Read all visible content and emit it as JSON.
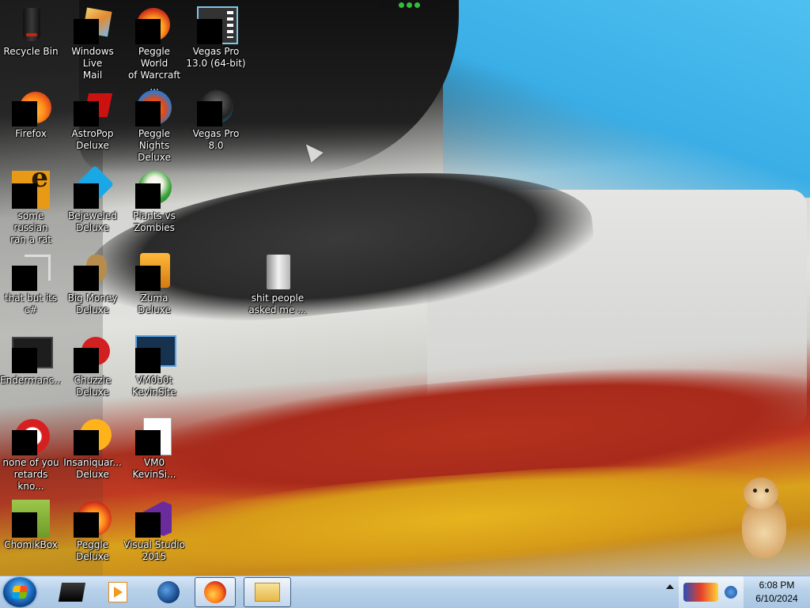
{
  "desktop": {
    "icons": [
      {
        "label": "Recycle Bin",
        "icon": "recycle-bin-icon"
      },
      {
        "label": "Windows Live\nMail",
        "icon": "mail-icon"
      },
      {
        "label": "Peggle World\nof Warcraft ...",
        "icon": "peggle-icon"
      },
      {
        "label": "Vegas Pro\n13.0 (64-bit)",
        "icon": "vegas-icon"
      },
      {
        "label": "Firefox",
        "icon": "firefox-icon"
      },
      {
        "label": "AstroPop\nDeluxe",
        "icon": "astropop-icon"
      },
      {
        "label": "Peggle Nights\nDeluxe",
        "icon": "peggle-nights-icon"
      },
      {
        "label": "Vegas Pro 8.0",
        "icon": "vegas-8-icon"
      },
      {
        "label": "some russian\nran a rat",
        "icon": "rat-icon"
      },
      {
        "label": "Bejeweled\nDeluxe",
        "icon": "bejeweled-icon"
      },
      {
        "label": "Plants vs\nZombies",
        "icon": "pvz-icon"
      },
      {
        "label": "that but its c#",
        "icon": "shortcut-icon"
      },
      {
        "label": "Big Money\nDeluxe",
        "icon": "big-money-icon"
      },
      {
        "label": "Zuma Deluxe",
        "icon": "zuma-icon"
      },
      {
        "label": "shit people\nasked me ...",
        "icon": "folder-icon"
      },
      {
        "label": "Endermanc...",
        "icon": "enderman-icon"
      },
      {
        "label": "Chuzzle\nDeluxe",
        "icon": "chuzzle-icon"
      },
      {
        "label": "VM0b0t\nKevinSite",
        "icon": "vm-icon"
      },
      {
        "label": "none of you\nretards kno...",
        "icon": "chrome-like-icon"
      },
      {
        "label": "Insaniquar...\nDeluxe",
        "icon": "insaniquarium-icon"
      },
      {
        "label": "VM0\nKevinSi...",
        "icon": "document-icon"
      },
      {
        "label": "ChomikBox",
        "icon": "chomikbox-icon"
      },
      {
        "label": "Peggle Deluxe",
        "icon": "peggle-deluxe-icon"
      },
      {
        "label": "Visual Studio\n2015",
        "icon": "visual-studio-icon"
      }
    ]
  },
  "taskbar": {
    "start_icon": "windows-start-icon",
    "pinned": [
      {
        "icon": "black-app-icon",
        "active": false
      },
      {
        "icon": "media-player-icon",
        "active": false
      },
      {
        "icon": "globe-icon",
        "active": false
      },
      {
        "icon": "firefox-icon",
        "active": true
      },
      {
        "icon": "explorer-icon",
        "active": true
      }
    ],
    "clock_time": "6:08 PM",
    "clock_date": "6/10/2024"
  },
  "colors": {
    "taskbar": "#b9d2ea",
    "icon_label": "#ffffff"
  }
}
